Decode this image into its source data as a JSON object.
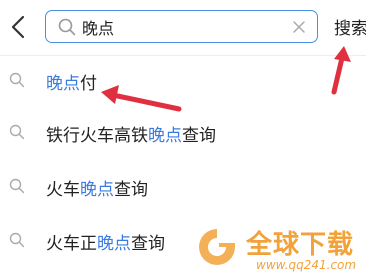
{
  "header": {
    "back_icon": "chevron-left-icon",
    "search": {
      "value": "晚点",
      "placeholder": "",
      "icon": "search-icon",
      "clear_icon": "clear-icon"
    },
    "search_button_label": "搜索"
  },
  "suggestions": [
    {
      "pre": "",
      "highlight": "晚点",
      "post": "付"
    },
    {
      "pre": "铁行火车高铁",
      "highlight": "晚点",
      "post": "查询"
    },
    {
      "pre": "火车",
      "highlight": "晚点",
      "post": "查询"
    },
    {
      "pre": "火车正",
      "highlight": "晚点",
      "post": "查询"
    }
  ],
  "watermark": {
    "text": "全球下载",
    "url": "www.qq241.com"
  },
  "colors": {
    "accent": "#4a90e2",
    "highlight": "#3a7be0",
    "annotation_arrow": "#e03040",
    "watermark": "#f2a23a"
  }
}
